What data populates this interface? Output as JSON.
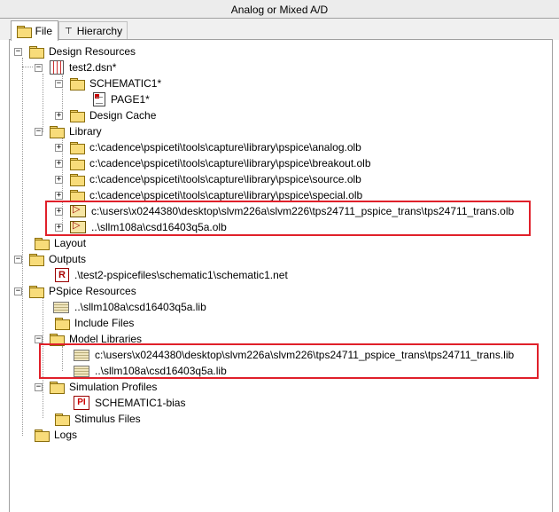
{
  "window": {
    "title": "Analog or Mixed A/D"
  },
  "tabs": [
    {
      "label": "File"
    },
    {
      "label": "Hierarchy"
    }
  ],
  "tree": {
    "design_resources": "Design Resources",
    "dsn": "test2.dsn*",
    "schematic": "SCHEMATIC1*",
    "page": "PAGE1*",
    "design_cache": "Design Cache",
    "library": "Library",
    "libs": [
      "c:\\cadence\\pspiceti\\tools\\capture\\library\\pspice\\analog.olb",
      "c:\\cadence\\pspiceti\\tools\\capture\\library\\pspice\\breakout.olb",
      "c:\\cadence\\pspiceti\\tools\\capture\\library\\pspice\\source.olb",
      "c:\\cadence\\pspiceti\\tools\\capture\\library\\pspice\\special.olb",
      "c:\\users\\x0244380\\desktop\\slvm226a\\slvm226\\tps24711_pspice_trans\\tps24711_trans.olb",
      "..\\sllm108a\\csd16403q5a.olb"
    ],
    "layout": "Layout",
    "outputs": "Outputs",
    "netlist": ".\\test2-pspicefiles\\schematic1\\schematic1.net",
    "pspice_resources": "PSpice Resources",
    "pspice_lib": "..\\sllm108a\\csd16403q5a.lib",
    "include_files": "Include Files",
    "model_libraries": "Model Libraries",
    "models": [
      "c:\\users\\x0244380\\desktop\\slvm226a\\slvm226\\tps24711_pspice_trans\\tps24711_trans.lib",
      "..\\sllm108a\\csd16403q5a.lib"
    ],
    "simulation_profiles": "Simulation Profiles",
    "profile": "SCHEMATIC1-bias",
    "stimulus_files": "Stimulus Files",
    "logs": "Logs"
  },
  "colors": {
    "highlight": "#e0202a",
    "folder": "#f8dc7a"
  }
}
